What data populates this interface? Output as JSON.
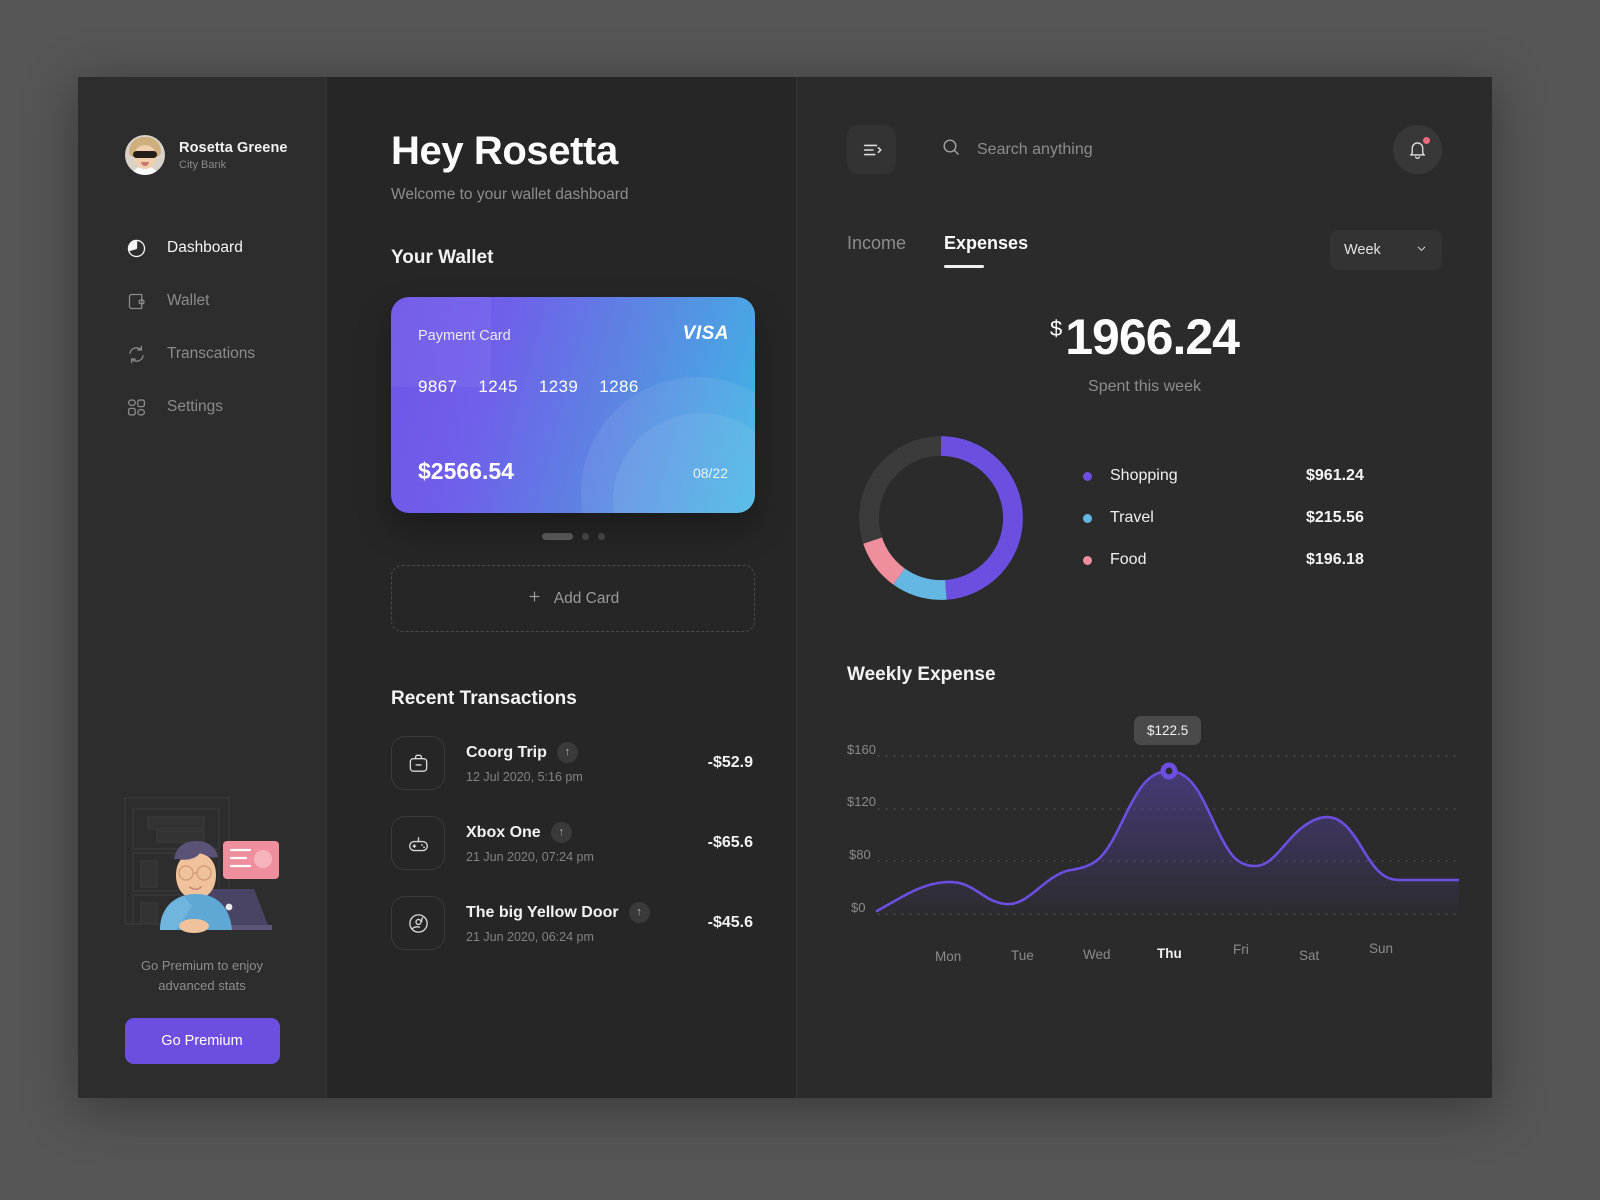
{
  "sidebar": {
    "profile": {
      "name": "Rosetta Greene",
      "bank": "City Bank"
    },
    "nav": [
      {
        "label": "Dashboard",
        "icon": "pie-chart-icon",
        "active": true
      },
      {
        "label": "Wallet",
        "icon": "wallet-icon",
        "active": false
      },
      {
        "label": "Transcations",
        "icon": "sync-icon",
        "active": false
      },
      {
        "label": "Settings",
        "icon": "layout-blocks-icon",
        "active": false
      }
    ],
    "promo": {
      "text": "Go Premium to enjoy advanced stats",
      "button": "Go Premium",
      "button_color": "#6c4fe0"
    }
  },
  "center": {
    "greeting": "Hey Rosetta",
    "welcome": "Welcome to your wallet dashboard",
    "wallet_title": "Your Wallet",
    "card": {
      "label": "Payment Card",
      "brand": "VISA",
      "number_groups": [
        "9867",
        "1245",
        "1239",
        "1286"
      ],
      "balance": "$2566.54",
      "expiry": "08/22"
    },
    "carousel": {
      "active_index": 0,
      "count": 3
    },
    "add_card": "Add Card",
    "transactions_title": "Recent Transactions",
    "transactions": [
      {
        "icon": "briefcase-icon",
        "name": "Coorg Trip",
        "badge": "↑",
        "date": "12 Jul 2020, 5:16 pm",
        "amount": "-$52.9"
      },
      {
        "icon": "gamepad-icon",
        "name": "Xbox One",
        "badge": "↑",
        "date": "21 Jun 2020, 07:24 pm",
        "amount": "-$65.6"
      },
      {
        "icon": "ball-icon",
        "name": "The big Yellow Door",
        "badge": "↑",
        "date": "21 Jun 2020, 06:24 pm",
        "amount": "-$45.6"
      }
    ]
  },
  "right": {
    "search_placeholder": "Search anything",
    "tabs": [
      {
        "label": "Income",
        "active": false
      },
      {
        "label": "Expenses",
        "active": true
      }
    ],
    "period": {
      "value": "Week"
    },
    "total": {
      "currency": "$",
      "amount": "1966.24",
      "caption": "Spent this week"
    },
    "weekly_title": "Weekly Expense"
  },
  "chart_data": [
    {
      "type": "pie",
      "title": "Expenses breakdown",
      "categories": [
        "Shopping",
        "Travel",
        "Food",
        "Remaining"
      ],
      "values": [
        961.24,
        215.56,
        196.18,
        593.26
      ],
      "labels": [
        "$961.24",
        "$215.56",
        "$196.18",
        ""
      ],
      "colors": [
        "#6c4fe0",
        "#64b6e3",
        "#ef8e9c",
        "#3b3b3b"
      ],
      "legend": [
        {
          "name": "Shopping",
          "value": "$961.24",
          "color": "#6c4fe0"
        },
        {
          "name": "Travel",
          "value": "$215.56",
          "color": "#64b6e3"
        },
        {
          "name": "Food",
          "value": "$196.18",
          "color": "#ef8e9c"
        }
      ],
      "total": 1966.24,
      "donut": true
    },
    {
      "type": "area",
      "title": "Weekly Expense",
      "x": [
        "Mon",
        "Tue",
        "Wed",
        "Thu",
        "Fri",
        "Sat",
        "Sun"
      ],
      "values": [
        44,
        52,
        70,
        122.5,
        79,
        112,
        56
      ],
      "ylabel": "",
      "xlabel": "",
      "ylim": [
        0,
        180
      ],
      "yticks": [
        0,
        80,
        120,
        160
      ],
      "ytick_labels": [
        "$0",
        "$80",
        "$120",
        "$160"
      ],
      "grid": true,
      "line_color": "#6c4fe0",
      "highlight": {
        "x": "Thu",
        "value": "$122.5"
      }
    }
  ]
}
